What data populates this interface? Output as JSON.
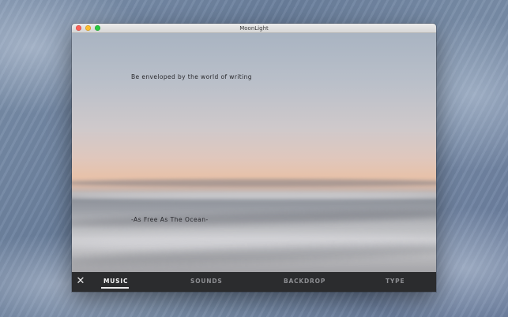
{
  "window": {
    "title": "MoonLight",
    "controls": [
      "close",
      "minimize",
      "maximize"
    ]
  },
  "content": {
    "quote": "Be enveloped by the world of writing",
    "subtitle": "-As Free As The Ocean-"
  },
  "toolbar": {
    "close_icon": "close-icon",
    "tabs": [
      {
        "label": "MUSIC",
        "active": true
      },
      {
        "label": "SOUNDS",
        "active": false
      },
      {
        "label": "BACKDROP",
        "active": false
      },
      {
        "label": "TYPE",
        "active": false
      }
    ]
  },
  "colors": {
    "toolbar_bg": "#2b2c2e",
    "active_tab": "#f3f3f4",
    "inactive_tab": "#8d8e92",
    "close_button": "#fc5f57",
    "minimize_button": "#fdbc2e",
    "maximize_button": "#2ac940"
  }
}
